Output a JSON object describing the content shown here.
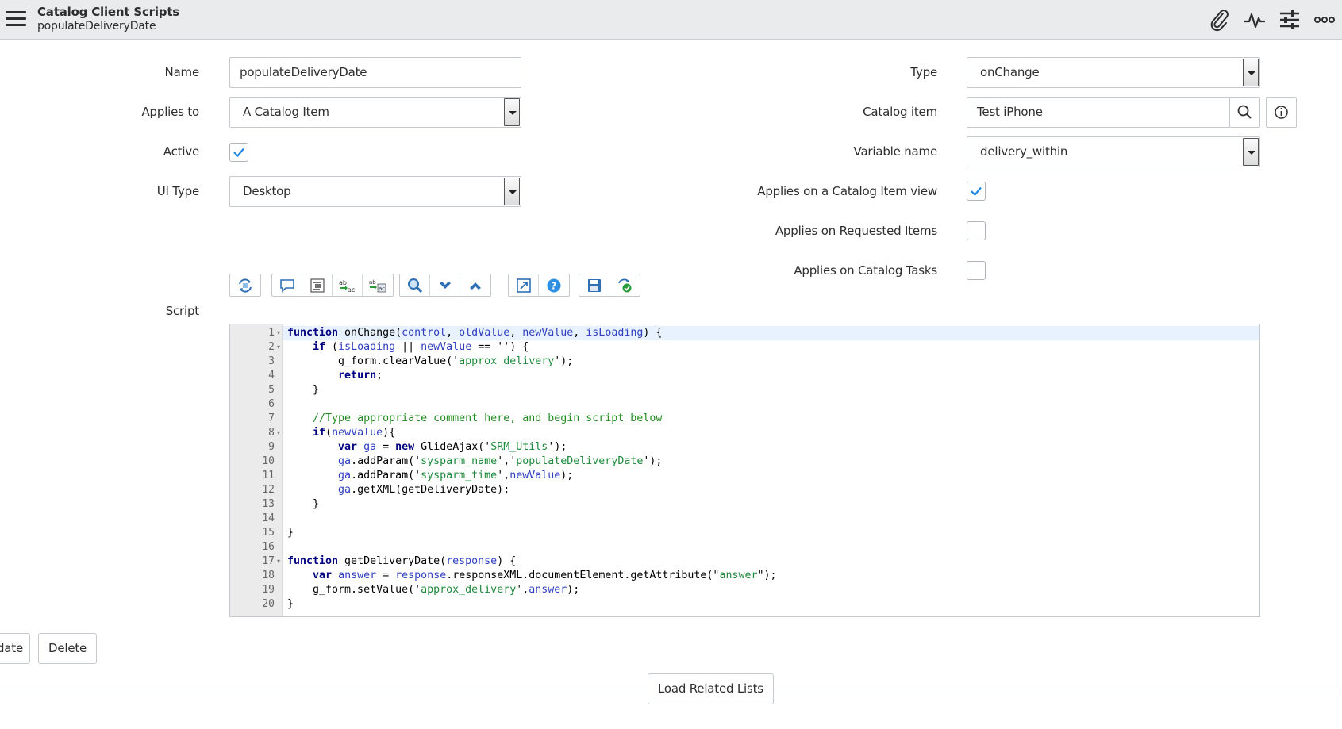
{
  "header": {
    "title": "Catalog Client Scripts",
    "subtitle": "populateDeliveryDate",
    "icons": [
      "menu-icon",
      "paperclip-icon",
      "activity-icon",
      "sliders-icon",
      "more-icon"
    ]
  },
  "form": {
    "name": {
      "label": "Name",
      "value": "populateDeliveryDate"
    },
    "applies_to": {
      "label": "Applies to",
      "value": "A Catalog Item"
    },
    "active": {
      "label": "Active",
      "checked": true
    },
    "ui_type": {
      "label": "UI Type",
      "value": "Desktop"
    },
    "type": {
      "label": "Type",
      "value": "onChange"
    },
    "catalog_item": {
      "label": "Catalog item",
      "value": "Test iPhone"
    },
    "variable_name": {
      "label": "Variable name",
      "value": "delivery_within"
    },
    "applies_catalog_view": {
      "label": "Applies on a Catalog Item view",
      "checked": true
    },
    "applies_requested": {
      "label": "Applies on Requested Items",
      "checked": false
    },
    "applies_tasks": {
      "label": "Applies on Catalog Tasks",
      "checked": false
    },
    "script": {
      "label": "Script"
    }
  },
  "toolbar": {
    "groups": [
      [
        "toggle-syntax-icon"
      ],
      [
        "comment-icon",
        "format-code-icon",
        "replace-icon",
        "replace-all-icon"
      ],
      [
        "search-icon",
        "find-next-icon",
        "find-previous-icon"
      ],
      [
        "fullscreen-icon",
        "help-icon"
      ],
      [
        "save-icon",
        "script-debug-icon"
      ]
    ]
  },
  "code": {
    "folds": [
      1,
      2,
      8,
      17
    ],
    "lines": [
      "function onChange(control, oldValue, newValue, isLoading) {",
      "    if (isLoading || newValue == '') {",
      "        g_form.clearValue('approx_delivery');",
      "        return;",
      "    }",
      "",
      "    //Type appropriate comment here, and begin script below",
      "    if(newValue){",
      "        var ga = new GlideAjax('SRM_Utils');",
      "        ga.addParam('sysparm_name','populateDeliveryDate');",
      "        ga.addParam('sysparm_time',newValue);",
      "        ga.getXML(getDeliveryDate);",
      "    }",
      "",
      "}",
      "",
      "function getDeliveryDate(response) {",
      "    var answer = response.responseXML.documentElement.getAttribute(\"answer\");",
      "    g_form.setValue('approx_delivery',answer);",
      "}"
    ]
  },
  "buttons": {
    "update": "Update",
    "delete": "Delete",
    "load_related": "Load Related Lists"
  },
  "colors": {
    "accent": "#1f8ae5",
    "header_bg": "#e9ebed"
  }
}
